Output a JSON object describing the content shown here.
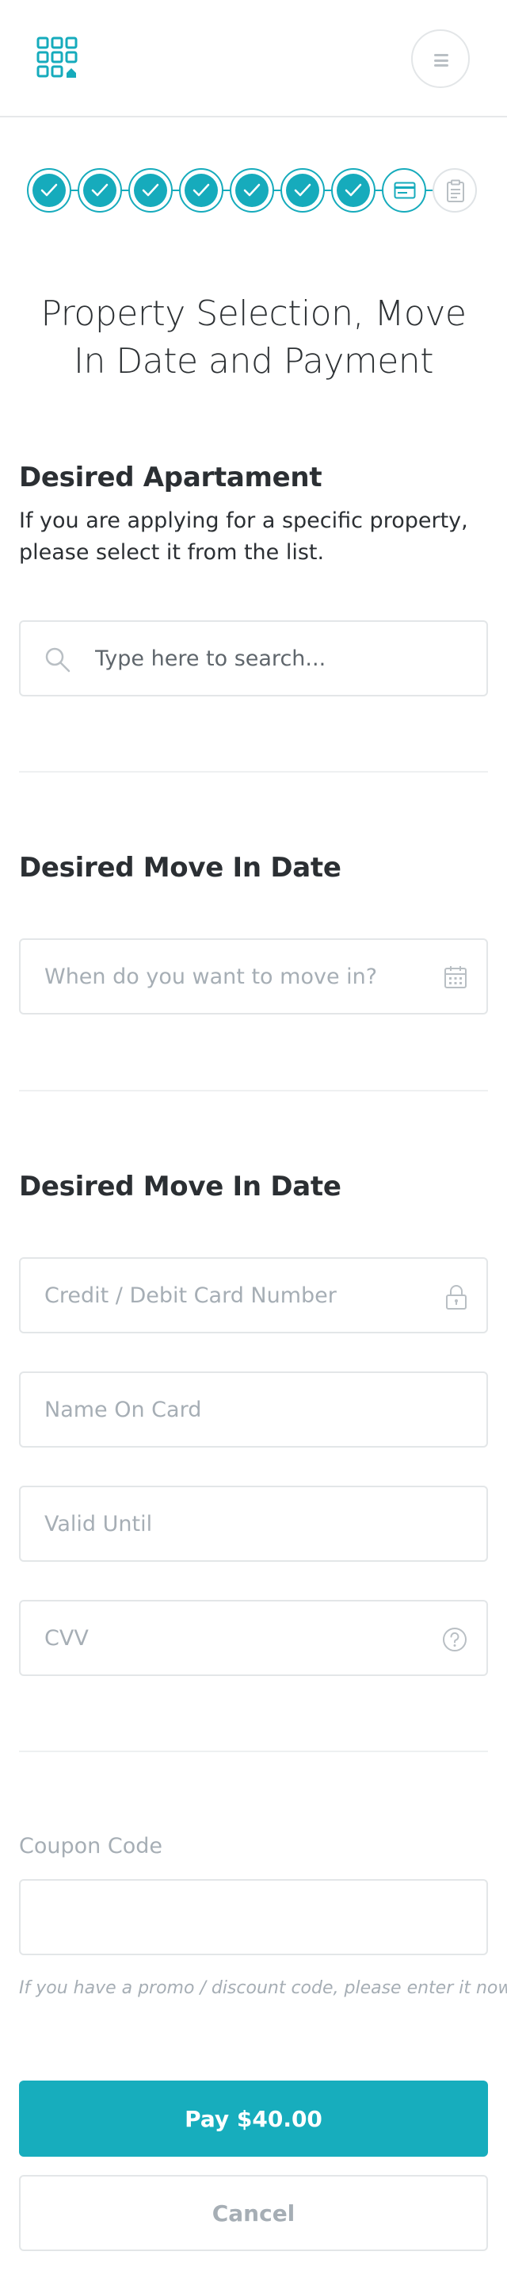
{
  "header": {
    "logo_icon": "keypad-home-logo-icon",
    "menu_icon": "hamburger-icon"
  },
  "stepper": {
    "completed_steps": 7,
    "current_step_icon": "credit-card-icon",
    "future_step_icon": "clipboard-icon",
    "accent_color": "#16abbc"
  },
  "page": {
    "title": "Property Selection, Move In Date and Payment"
  },
  "apartment": {
    "heading": "Desired Apartament",
    "description": "If you are applying for a specific property, please select it from the list.",
    "search_placeholder": "Type here to search..."
  },
  "move_in": {
    "heading": "Desired Move In Date",
    "date_placeholder": "When do you want to move in?"
  },
  "payment": {
    "heading": "Desired Move In Date",
    "card_number_placeholder": "Credit / Debit Card Number",
    "name_placeholder": "Name On Card",
    "valid_until_placeholder": "Valid Until",
    "cvv_placeholder": "CVV"
  },
  "coupon": {
    "label": "Coupon Code",
    "value": "",
    "help": "If you have a promo / discount code, please enter it now"
  },
  "actions": {
    "pay_label": "Pay $40.00",
    "cancel_label": "Cancel",
    "pay_color": "#17adbd"
  }
}
